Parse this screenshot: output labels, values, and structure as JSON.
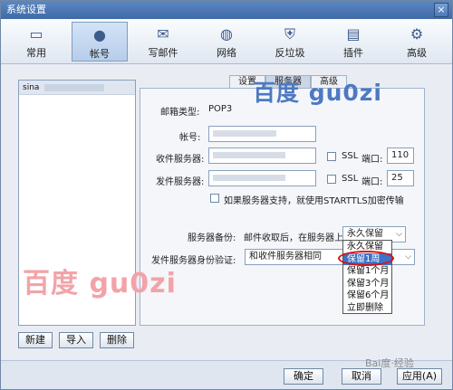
{
  "window": {
    "title": "系统设置",
    "close_label": "×"
  },
  "toolbar": {
    "items": [
      {
        "label": "常用",
        "icon": "general-icon",
        "glyph": "▭"
      },
      {
        "label": "帐号",
        "icon": "account-icon",
        "glyph": "●",
        "active": true
      },
      {
        "label": "写邮件",
        "icon": "compose-icon",
        "glyph": "✉"
      },
      {
        "label": "网络",
        "icon": "network-icon",
        "glyph": "◍"
      },
      {
        "label": "反垃圾",
        "icon": "shield-icon",
        "glyph": "⛨"
      },
      {
        "label": "插件",
        "icon": "plugin-icon",
        "glyph": "▤"
      },
      {
        "label": "高级",
        "icon": "gear-icon",
        "glyph": "⚙"
      }
    ]
  },
  "left_panel": {
    "account_prefix": "sina",
    "buttons": {
      "new": "新建",
      "import": "导入",
      "delete": "删除"
    }
  },
  "tabs": {
    "settings": "设置",
    "server": "服务器",
    "advanced": "高级"
  },
  "form": {
    "mailbox_type_label": "邮箱类型:",
    "mailbox_type_value": "POP3",
    "account_label": "帐号:",
    "incoming_label": "收件服务器:",
    "outgoing_label": "发件服务器:",
    "ssl_label": "SSL",
    "port_label": "端口:",
    "incoming_port": "110",
    "outgoing_port": "25",
    "starttls_label": "如果服务器支持，就使用STARTTLS加密传输",
    "backup_label": "服务器备份:",
    "backup_desc": "邮件收取后，在服务器上",
    "backup_value": "永久保留",
    "outgoing_auth_label": "发件服务器身份验证:",
    "outgoing_auth_value": "和收件服务器相同"
  },
  "dropdown": {
    "options": [
      "永久保留",
      "保留1周",
      "保留1个月",
      "保留3个月",
      "保留6个月",
      "立即删除"
    ],
    "selected_index": 1
  },
  "watermarks": {
    "main": "百度 gu0zi",
    "top": "百度 gu0zi",
    "corner": "Bai度·经验"
  },
  "footer": {
    "ok": "确定",
    "cancel": "取消",
    "apply": "应用(A)"
  },
  "colors": {
    "accent": "#3b73c8",
    "highlight": "#d11111"
  }
}
